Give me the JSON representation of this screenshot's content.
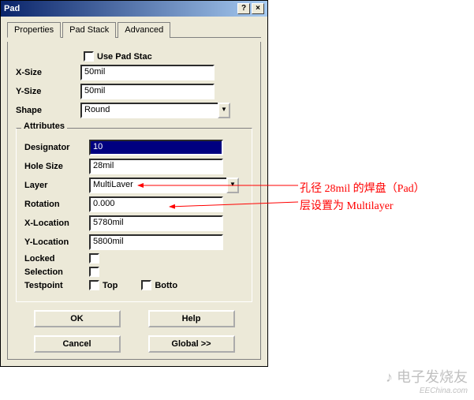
{
  "title": "Pad",
  "tabs": {
    "t0": "Properties",
    "t1": "Pad Stack",
    "t2": "Advanced"
  },
  "usePadStack_label": "Use Pad Stac",
  "sizes": {
    "xsize_label": "X-Size",
    "xsize": "50mil",
    "ysize_label": "Y-Size",
    "ysize": "50mil",
    "shape_label": "Shape",
    "shape": "Round"
  },
  "attributes": {
    "legend": "Attributes",
    "designator_label": "Designator",
    "designator": "10",
    "holesize_label": "Hole Size",
    "holesize": "28mil",
    "layer_label": "Layer",
    "layer": "MultiLaver",
    "rotation_label": "Rotation",
    "rotation": " 0.000",
    "xloc_label": "X-Location",
    "xloc": "5780mil",
    "yloc_label": "Y-Location",
    "yloc": "5800mil",
    "locked_label": "Locked",
    "selection_label": "Selection",
    "testpoint_label": "Testpoint",
    "testpoint_top": "Top",
    "testpoint_bottom": "Botto"
  },
  "buttons": {
    "ok": "OK",
    "help": "Help",
    "cancel": "Cancel",
    "global": "Global >>"
  },
  "annotations": {
    "line1": "孔径 28mil 的焊盘（Pad）",
    "line2": "层设置为 Multilayer"
  },
  "watermark": {
    "brand": "电子发烧友",
    "url": "EEChina.com"
  }
}
